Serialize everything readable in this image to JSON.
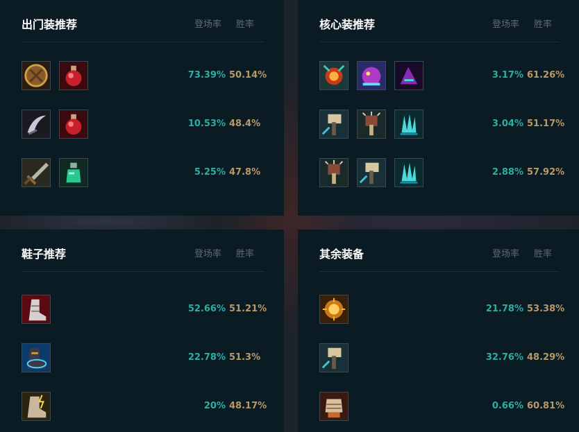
{
  "headers": {
    "rate": "登场率",
    "win": "胜率"
  },
  "sections": [
    {
      "title": "出门装推荐",
      "rows": [
        {
          "items": [
            "shield-item-icon",
            "health-potion-icon"
          ],
          "rate": "73.39%",
          "win": "50.14%"
        },
        {
          "items": [
            "sickle-item-icon",
            "health-potion-icon"
          ],
          "rate": "10.53%",
          "win": "48.4%"
        },
        {
          "items": [
            "long-sword-icon",
            "refillable-potion-icon"
          ],
          "rate": "5.25%",
          "win": "47.8%"
        }
      ]
    },
    {
      "title": "核心装推荐",
      "rows": [
        {
          "items": [
            "fire-relic-icon",
            "purple-dragon-icon",
            "shadow-dragon-icon"
          ],
          "rate": "3.17%",
          "win": "61.26%"
        },
        {
          "items": [
            "hammer-item-icon",
            "spiked-hammer-icon",
            "crystal-claw-icon"
          ],
          "rate": "3.04%",
          "win": "51.17%"
        },
        {
          "items": [
            "spiked-hammer-icon",
            "hammer-item-icon",
            "crystal-claw-icon"
          ],
          "rate": "2.88%",
          "win": "57.92%"
        }
      ]
    },
    {
      "title": "鞋子推荐",
      "rows": [
        {
          "items": [
            "plated-boots-icon"
          ],
          "rate": "52.66%",
          "win": "51.21%"
        },
        {
          "items": [
            "mercury-boots-icon"
          ],
          "rate": "22.78%",
          "win": "51.3%"
        },
        {
          "items": [
            "swift-boots-icon"
          ],
          "rate": "20%",
          "win": "48.17%"
        }
      ]
    },
    {
      "title": "其余装备",
      "rows": [
        {
          "items": [
            "golden-orb-icon"
          ],
          "rate": "21.78%",
          "win": "53.38%"
        },
        {
          "items": [
            "hammer-item-icon"
          ],
          "rate": "32.76%",
          "win": "48.29%"
        },
        {
          "items": [
            "armored-fist-icon"
          ],
          "rate": "0.66%",
          "win": "60.81%"
        }
      ]
    }
  ]
}
